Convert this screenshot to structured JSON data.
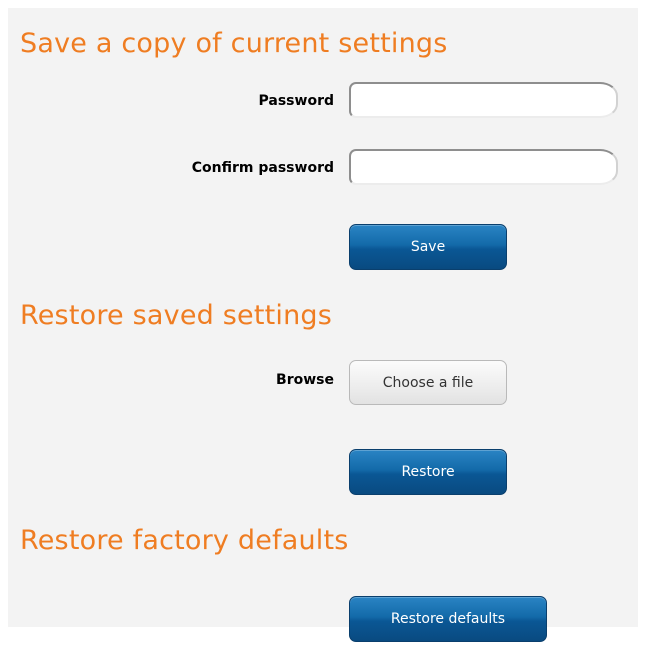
{
  "save_section": {
    "heading": "Save a copy of current settings",
    "password_label": "Password",
    "password_value": "",
    "confirm_label": "Confirm password",
    "confirm_value": "",
    "save_button": "Save"
  },
  "restore_section": {
    "heading": "Restore saved settings",
    "browse_label": "Browse",
    "choose_file_button": "Choose a file",
    "restore_button": "Restore"
  },
  "factory_section": {
    "heading": "Restore factory defaults",
    "restore_defaults_button": "Restore defaults"
  },
  "colors": {
    "heading": "#ef7d22",
    "button_blue": "#0d5a97",
    "panel_background": "#f3f3f3"
  }
}
